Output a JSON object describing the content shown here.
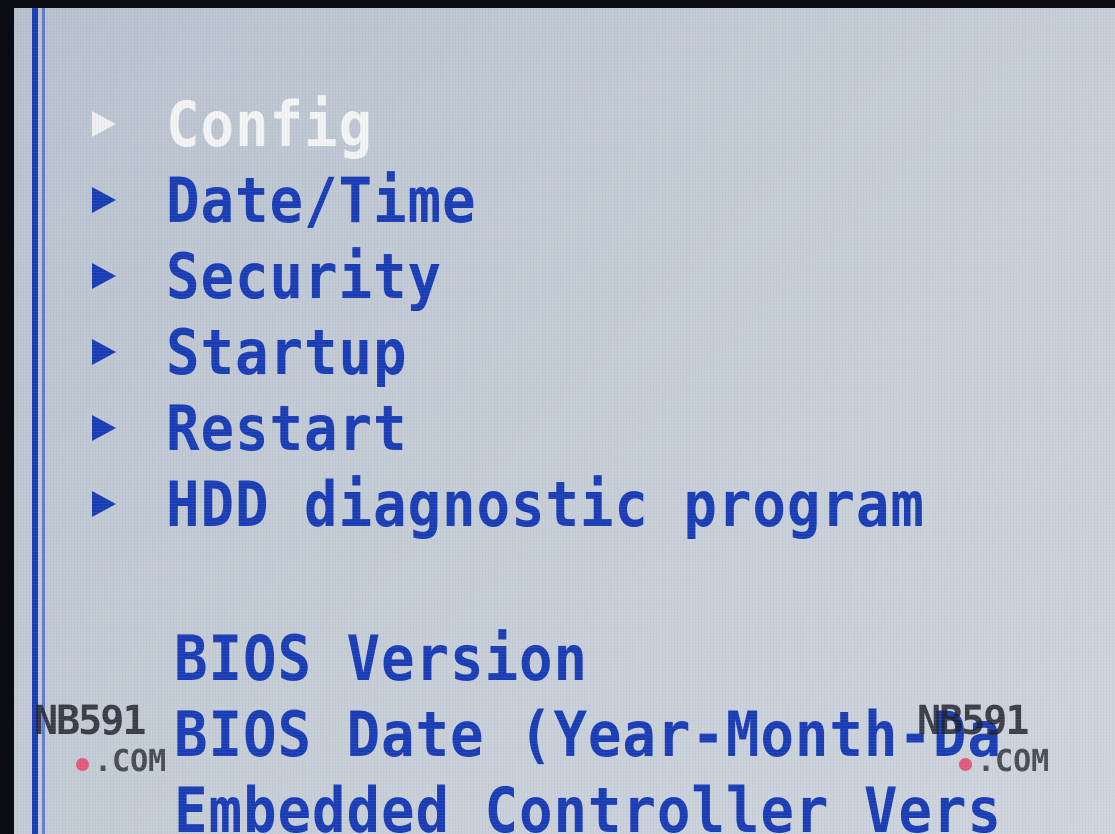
{
  "menu": {
    "items": [
      {
        "label": "Config",
        "selected": true
      },
      {
        "label": "Date/Time",
        "selected": false
      },
      {
        "label": "Security",
        "selected": false
      },
      {
        "label": "Startup",
        "selected": false
      },
      {
        "label": "Restart",
        "selected": false
      },
      {
        "label": "HDD diagnostic program",
        "selected": false
      }
    ]
  },
  "info": {
    "bios_version_label": "BIOS Version",
    "bios_date_label": "BIOS Date (Year-Month-Da",
    "ec_version_label": "Embedded Controller Vers"
  },
  "watermark": {
    "text": "NB591",
    "domain": ".COM"
  },
  "colors": {
    "accent": "#1a3db6",
    "selected": "#f3f4f6",
    "background": "#c4ccd6"
  },
  "icons": {
    "menu_arrow": "right-triangle-icon"
  }
}
